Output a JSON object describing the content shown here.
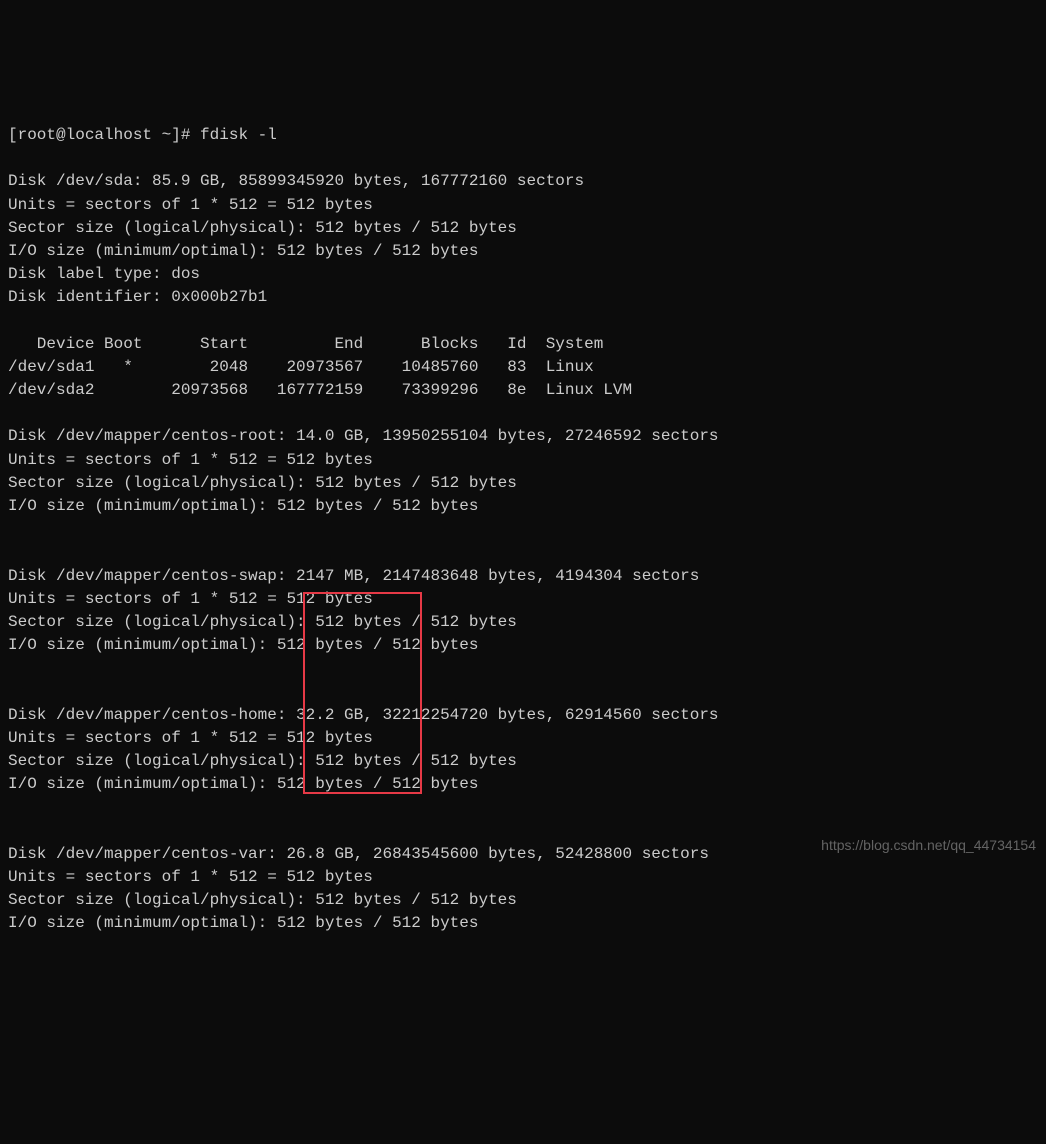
{
  "prompt": "[root@localhost ~]# fdisk -l",
  "disk_sda": {
    "header": "Disk /dev/sda: 85.9 GB, 85899345920 bytes, 167772160 sectors",
    "units": "Units = sectors of 1 * 512 = 512 bytes",
    "sector_size": "Sector size (logical/physical): 512 bytes / 512 bytes",
    "io_size": "I/O size (minimum/optimal): 512 bytes / 512 bytes",
    "label_type": "Disk label type: dos",
    "identifier": "Disk identifier: 0x000b27b1"
  },
  "partition_table": {
    "header": "   Device Boot      Start         End      Blocks   Id  System",
    "row1": "/dev/sda1   *        2048    20973567    10485760   83  Linux",
    "row2": "/dev/sda2        20973568   167772159    73399296   8e  Linux LVM"
  },
  "disk_root": {
    "header": "Disk /dev/mapper/centos-root: 14.0 GB, 13950255104 bytes, 27246592 sectors",
    "units": "Units = sectors of 1 * 512 = 512 bytes",
    "sector_size": "Sector size (logical/physical): 512 bytes / 512 bytes",
    "io_size": "I/O size (minimum/optimal): 512 bytes / 512 bytes"
  },
  "disk_swap": {
    "header": "Disk /dev/mapper/centos-swap: 2147 MB, 2147483648 bytes, 4194304 sectors",
    "units": "Units = sectors of 1 * 512 = 512 bytes",
    "sector_size": "Sector size (logical/physical): 512 bytes / 512 bytes",
    "io_size": "I/O size (minimum/optimal): 512 bytes / 512 bytes"
  },
  "disk_home": {
    "header": "Disk /dev/mapper/centos-home: 32.2 GB, 32212254720 bytes, 62914560 sectors",
    "units": "Units = sectors of 1 * 512 = 512 bytes",
    "sector_size": "Sector size (logical/physical): 512 bytes / 512 bytes",
    "io_size": "I/O size (minimum/optimal): 512 bytes / 512 bytes"
  },
  "disk_var": {
    "header": "Disk /dev/mapper/centos-var: 26.8 GB, 26843545600 bytes, 52428800 sectors",
    "units": "Units = sectors of 1 * 512 = 512 bytes",
    "sector_size": "Sector size (logical/physical): 512 bytes / 512 bytes",
    "io_size": "I/O size (minimum/optimal): 512 bytes / 512 bytes"
  },
  "watermark": "https://blog.csdn.net/qq_44734154"
}
